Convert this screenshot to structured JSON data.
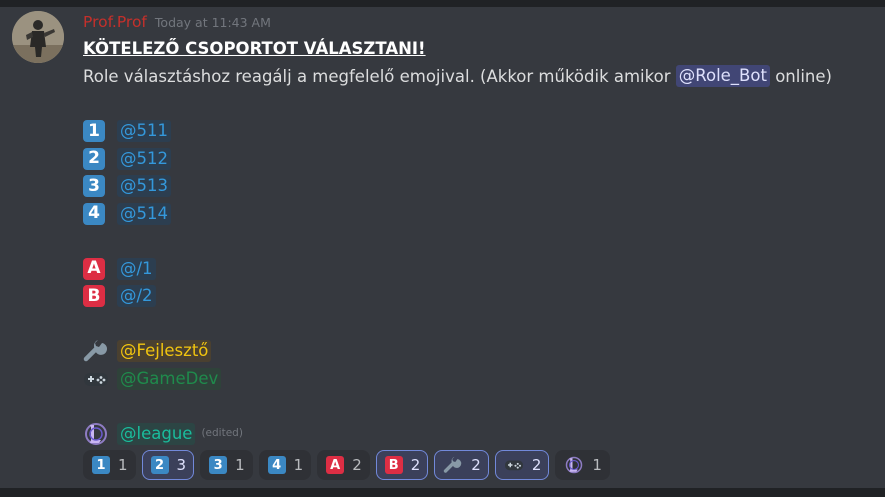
{
  "message": {
    "author": "Prof.Prof",
    "timestamp": "Today at 11:43 AM",
    "title": "KÖTELEZŐ CSOPORTOT VÁLASZTANI!",
    "intro_before": "Role választáshoz reagálj a megfelelő emojival. (Akkor működik amikor ",
    "bot_mention": "@Role_Bot",
    "intro_after": " online)",
    "roles": [
      {
        "key": "1",
        "mention": "@511"
      },
      {
        "key": "2",
        "mention": "@512"
      },
      {
        "key": "3",
        "mention": "@513"
      },
      {
        "key": "4",
        "mention": "@514"
      },
      {
        "key": "A",
        "mention": "@/1"
      },
      {
        "key": "B",
        "mention": "@/2"
      },
      {
        "icon": "wrench-icon",
        "mention": "@Fejlesztő"
      },
      {
        "icon": "game-controller-icon",
        "mention": "@GameDev"
      },
      {
        "icon": "league-of-legends-icon",
        "mention": "@league"
      }
    ],
    "edited_label": "(edited)"
  },
  "reactions": [
    {
      "emoji": "1",
      "count": "1",
      "me": false
    },
    {
      "emoji": "2",
      "count": "3",
      "me": true
    },
    {
      "emoji": "3",
      "count": "1",
      "me": false
    },
    {
      "emoji": "4",
      "count": "1",
      "me": false
    },
    {
      "emoji": "A",
      "count": "2",
      "me": false
    },
    {
      "emoji": "B",
      "count": "2",
      "me": true
    },
    {
      "emoji": "wrench-icon",
      "count": "2",
      "me": true
    },
    {
      "emoji": "game-controller-icon",
      "count": "2",
      "me": true
    },
    {
      "emoji": "league-of-legends-icon",
      "count": "1",
      "me": false
    }
  ],
  "colors": {
    "background": "#36393f",
    "username": "#c4302b",
    "keycap_blue": "#3b88c3",
    "keycap_red": "#dd2e44",
    "role_blue": "#3498db",
    "role_yellow": "#f1c40f",
    "role_green": "#1f8b4c",
    "role_teal": "#1abc9c",
    "mention_bot_bg": "#414675"
  }
}
